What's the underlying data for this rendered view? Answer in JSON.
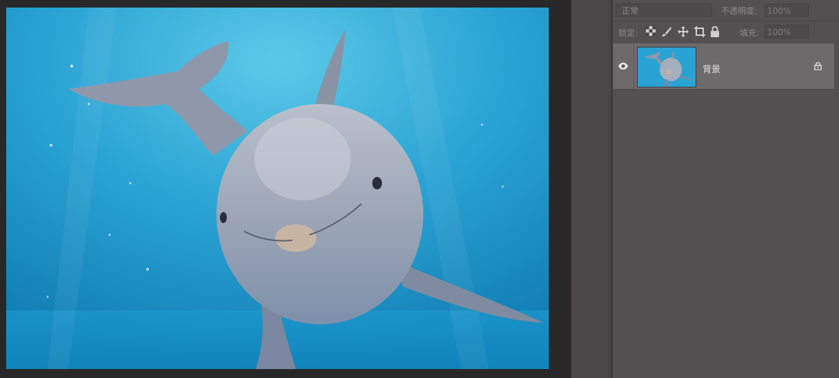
{
  "canvas": {
    "image_subject": "dolphin-underwater-photo"
  },
  "layers_panel": {
    "blend_mode": "正常",
    "opacity_label": "不透明度:",
    "opacity_value": "100%",
    "lock_label": "锁定:",
    "fill_label": "填充:",
    "fill_value": "100%",
    "lock_icons": [
      "lock-transparent-pixels-icon",
      "lock-image-pixels-icon",
      "lock-position-icon",
      "lock-artboard-icon",
      "lock-all-icon"
    ],
    "layers": [
      {
        "name": "背景",
        "visible": true,
        "locked": true
      }
    ]
  },
  "colors": {
    "panel_bg": "#545052",
    "selected_layer_bg": "#6e696b",
    "canvas_bg": "#282828",
    "water_blue": "#2aa4d3"
  }
}
